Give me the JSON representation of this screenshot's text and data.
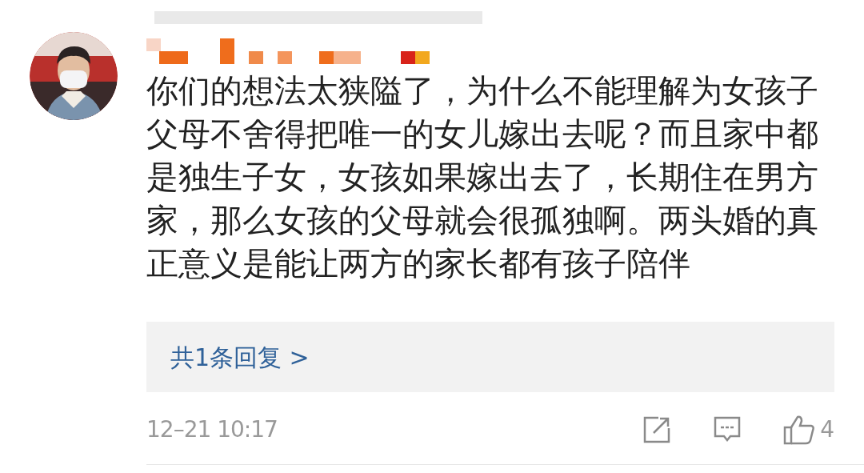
{
  "comment": {
    "text": "你们的想法太狭隘了，为什么不能理解为女孩子父母不舍得把唯一的女儿嫁出去呢？而且家中都是独生子女，女孩如果嫁出去了，长期住在男方家，那么女孩的父母就会很孤独啊。两头婚的真正意义是能让两方的家长都有孩子陪伴",
    "replies_link": "共1条回复 >",
    "timestamp": "12–21 10:17",
    "like_count": "4"
  }
}
